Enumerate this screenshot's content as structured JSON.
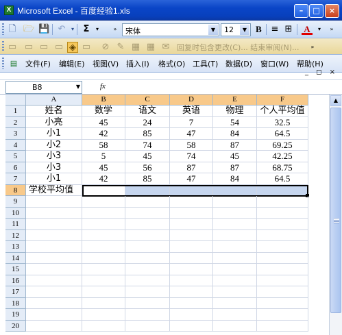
{
  "window": {
    "title": "Microsoft Excel - 百度经验1.xls",
    "app_icon": "X"
  },
  "toolbar": {
    "font_name": "宋体",
    "font_size": "12",
    "bold_label": "B",
    "sum_label": "Σ",
    "reviewing_text": "回复时包含更改(C)...  结束审阅(N)..."
  },
  "menu": {
    "items": [
      "文件(F)",
      "编辑(E)",
      "视图(V)",
      "插入(I)",
      "格式(O)",
      "工具(T)",
      "数据(D)",
      "窗口(W)",
      "帮助(H)"
    ],
    "controls": "_ ◻ ×"
  },
  "formula_bar": {
    "name_box": "B8",
    "fx_label": "fx",
    "content": ""
  },
  "sheet": {
    "columns": [
      "A",
      "B",
      "C",
      "D",
      "E",
      "F"
    ],
    "row_numbers": [
      "1",
      "2",
      "3",
      "4",
      "5",
      "6",
      "7",
      "8",
      "9",
      "10",
      "11",
      "12",
      "13",
      "14",
      "15",
      "16",
      "17",
      "18",
      "19",
      "20"
    ],
    "selected_row": "8",
    "selected_columns": [
      "B",
      "C",
      "D",
      "E",
      "F"
    ],
    "rows": [
      [
        "姓名",
        "数学",
        "语文",
        "英语",
        "物理",
        "个人平均值"
      ],
      [
        "小亮",
        "45",
        "24",
        "7",
        "54",
        "32.5"
      ],
      [
        "小1",
        "42",
        "85",
        "47",
        "84",
        "64.5"
      ],
      [
        "小2",
        "58",
        "74",
        "58",
        "87",
        "69.25"
      ],
      [
        "小3",
        "5",
        "45",
        "74",
        "45",
        "42.25"
      ],
      [
        "小3",
        "45",
        "56",
        "87",
        "87",
        "68.75"
      ],
      [
        "小1",
        "42",
        "85",
        "47",
        "84",
        "64.5"
      ],
      [
        "学校平均值",
        "",
        "",
        "",
        "",
        ""
      ]
    ]
  }
}
